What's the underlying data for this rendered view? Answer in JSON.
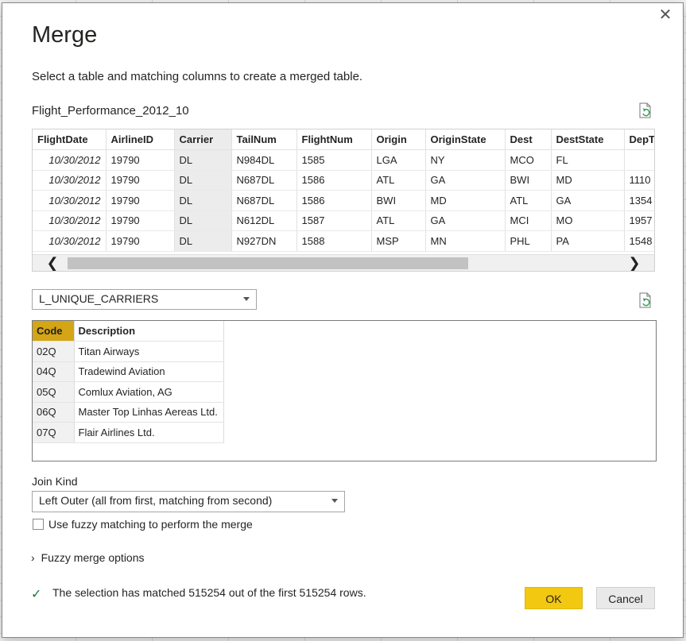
{
  "dialog": {
    "title": "Merge",
    "subtitle": "Select a table and matching columns to create a merged table.",
    "close_glyph": "✕"
  },
  "first_table": {
    "name": "Flight_Performance_2012_10",
    "columns": [
      "FlightDate",
      "AirlineID",
      "Carrier",
      "TailNum",
      "FlightNum",
      "Origin",
      "OriginState",
      "Dest",
      "DestState",
      "DepTi"
    ],
    "rows": [
      [
        "10/30/2012",
        "19790",
        "DL",
        "N984DL",
        "1585",
        "LGA",
        "NY",
        "MCO",
        "FL",
        ""
      ],
      [
        "10/30/2012",
        "19790",
        "DL",
        "N687DL",
        "1586",
        "ATL",
        "GA",
        "BWI",
        "MD",
        "1110"
      ],
      [
        "10/30/2012",
        "19790",
        "DL",
        "N687DL",
        "1586",
        "BWI",
        "MD",
        "ATL",
        "GA",
        "1354"
      ],
      [
        "10/30/2012",
        "19790",
        "DL",
        "N612DL",
        "1587",
        "ATL",
        "GA",
        "MCI",
        "MO",
        "1957"
      ],
      [
        "10/30/2012",
        "19790",
        "DL",
        "N927DN",
        "1588",
        "MSP",
        "MN",
        "PHL",
        "PA",
        "1548"
      ]
    ],
    "scroll_left": "❮",
    "scroll_right": "❯"
  },
  "second_table": {
    "selected": "L_UNIQUE_CARRIERS",
    "columns": [
      "Code",
      "Description"
    ],
    "rows": [
      [
        "02Q",
        "Titan Airways"
      ],
      [
        "04Q",
        "Tradewind Aviation"
      ],
      [
        "05Q",
        "Comlux Aviation, AG"
      ],
      [
        "06Q",
        "Master Top Linhas Aereas Ltd."
      ],
      [
        "07Q",
        "Flair Airlines Ltd."
      ]
    ]
  },
  "join": {
    "label": "Join Kind",
    "selected": "Left Outer (all from first, matching from second)",
    "fuzzy_checkbox_label": "Use fuzzy matching to perform the merge",
    "fuzzy_options_label": "Fuzzy merge options"
  },
  "status": {
    "text": "The selection has matched 515254 out of the first 515254 rows."
  },
  "buttons": {
    "ok": "OK",
    "cancel": "Cancel"
  },
  "colors": {
    "accent": "#f2c811",
    "selected_column_header": "#d4a514",
    "success": "#107c41"
  },
  "icons": {
    "refresh": "refresh-icon",
    "close": "close-icon",
    "check": "checkmark-icon",
    "dropdown": "chevron-down-icon"
  }
}
